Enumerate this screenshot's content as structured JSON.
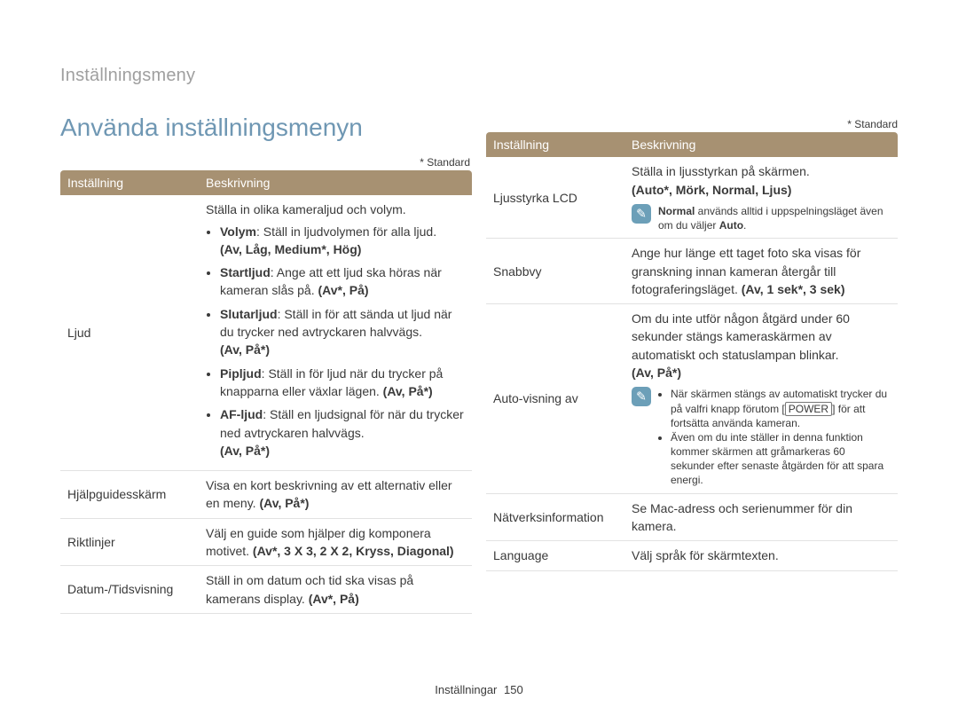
{
  "section_title": "Inställningsmeny",
  "main_title": "Använda inställningsmenyn",
  "standard_marker": "* Standard",
  "table_headers": {
    "setting": "Inställning",
    "description": "Beskrivning"
  },
  "left_rows": {
    "ljud": {
      "name": "Ljud",
      "intro": "Ställa in olika kameraljud och volym.",
      "items": [
        {
          "label": "Volym",
          "text": ": Ställ in ljudvolymen för alla ljud.",
          "options": "(Av, Låg, Medium*, Hög)"
        },
        {
          "label": "Startljud",
          "text": ": Ange att ett ljud ska höras när kameran slås på. ",
          "options": "(Av*, På)"
        },
        {
          "label": "Slutarljud",
          "text": ": Ställ in för att sända ut ljud när du trycker ned avtryckaren halvvägs.",
          "options": "(Av, På*)"
        },
        {
          "label": "Pipljud",
          "text": ": Ställ in för ljud när du trycker på knapparna eller växlar lägen. ",
          "options": "(Av, På*)"
        },
        {
          "label": "AF-ljud",
          "text": ": Ställ en ljudsignal för när du trycker ned avtryckaren halvvägs.",
          "options": "(Av, På*)"
        }
      ]
    },
    "hjalp": {
      "name": "Hjälpguidesskärm",
      "text": "Visa en kort beskrivning av ett alternativ eller en meny. ",
      "options": "(Av, På*)"
    },
    "riktlinjer": {
      "name": "Riktlinjer",
      "text": "Välj en guide som hjälper dig komponera motivet. ",
      "options": "(Av*, 3 X 3, 2 X 2, Kryss, Diagonal)"
    },
    "datum": {
      "name": "Datum-/Tidsvisning",
      "text": "Ställ in om datum och tid ska visas på kamerans display. ",
      "options": "(Av*, På)"
    }
  },
  "right_rows": {
    "ljusstyrka": {
      "name": "Ljusstyrka LCD",
      "text": "Ställa in ljusstyrkan på skärmen.",
      "options": "(Auto*, Mörk, Normal, Ljus)",
      "note_pre": "Normal",
      "note_mid": " används alltid i uppspelningsläget även om du väljer ",
      "note_post": "Auto",
      "note_end": "."
    },
    "snabbvy": {
      "name": "Snabbvy",
      "text": "Ange hur länge ett taget foto ska visas för granskning innan kameran återgår till fotograferingsläget. ",
      "options": "(Av, 1 sek*, 3 sek)"
    },
    "autovisning": {
      "name": "Auto-visning av",
      "text": "Om du inte utför någon åtgärd under 60 sekunder stängs kameraskärmen av automatiskt och statuslampan blinkar.",
      "options": "(Av, På*)",
      "note_items": [
        {
          "pre": "När skärmen stängs av automatiskt trycker du på valfri knapp förutom [",
          "boxed": "POWER",
          "post": "] för att fortsätta använda kameran."
        },
        {
          "text": "Även om du inte ställer in denna funktion kommer skärmen att gråmarkeras 60 sekunder efter senaste åtgärden för att spara energi."
        }
      ]
    },
    "natverk": {
      "name": "Nätverksinformation",
      "text": "Se Mac-adress och serienummer för din kamera."
    },
    "language": {
      "name": "Language",
      "text": "Välj språk för skärmtexten."
    }
  },
  "footer": {
    "label": "Inställningar",
    "page": "150"
  }
}
